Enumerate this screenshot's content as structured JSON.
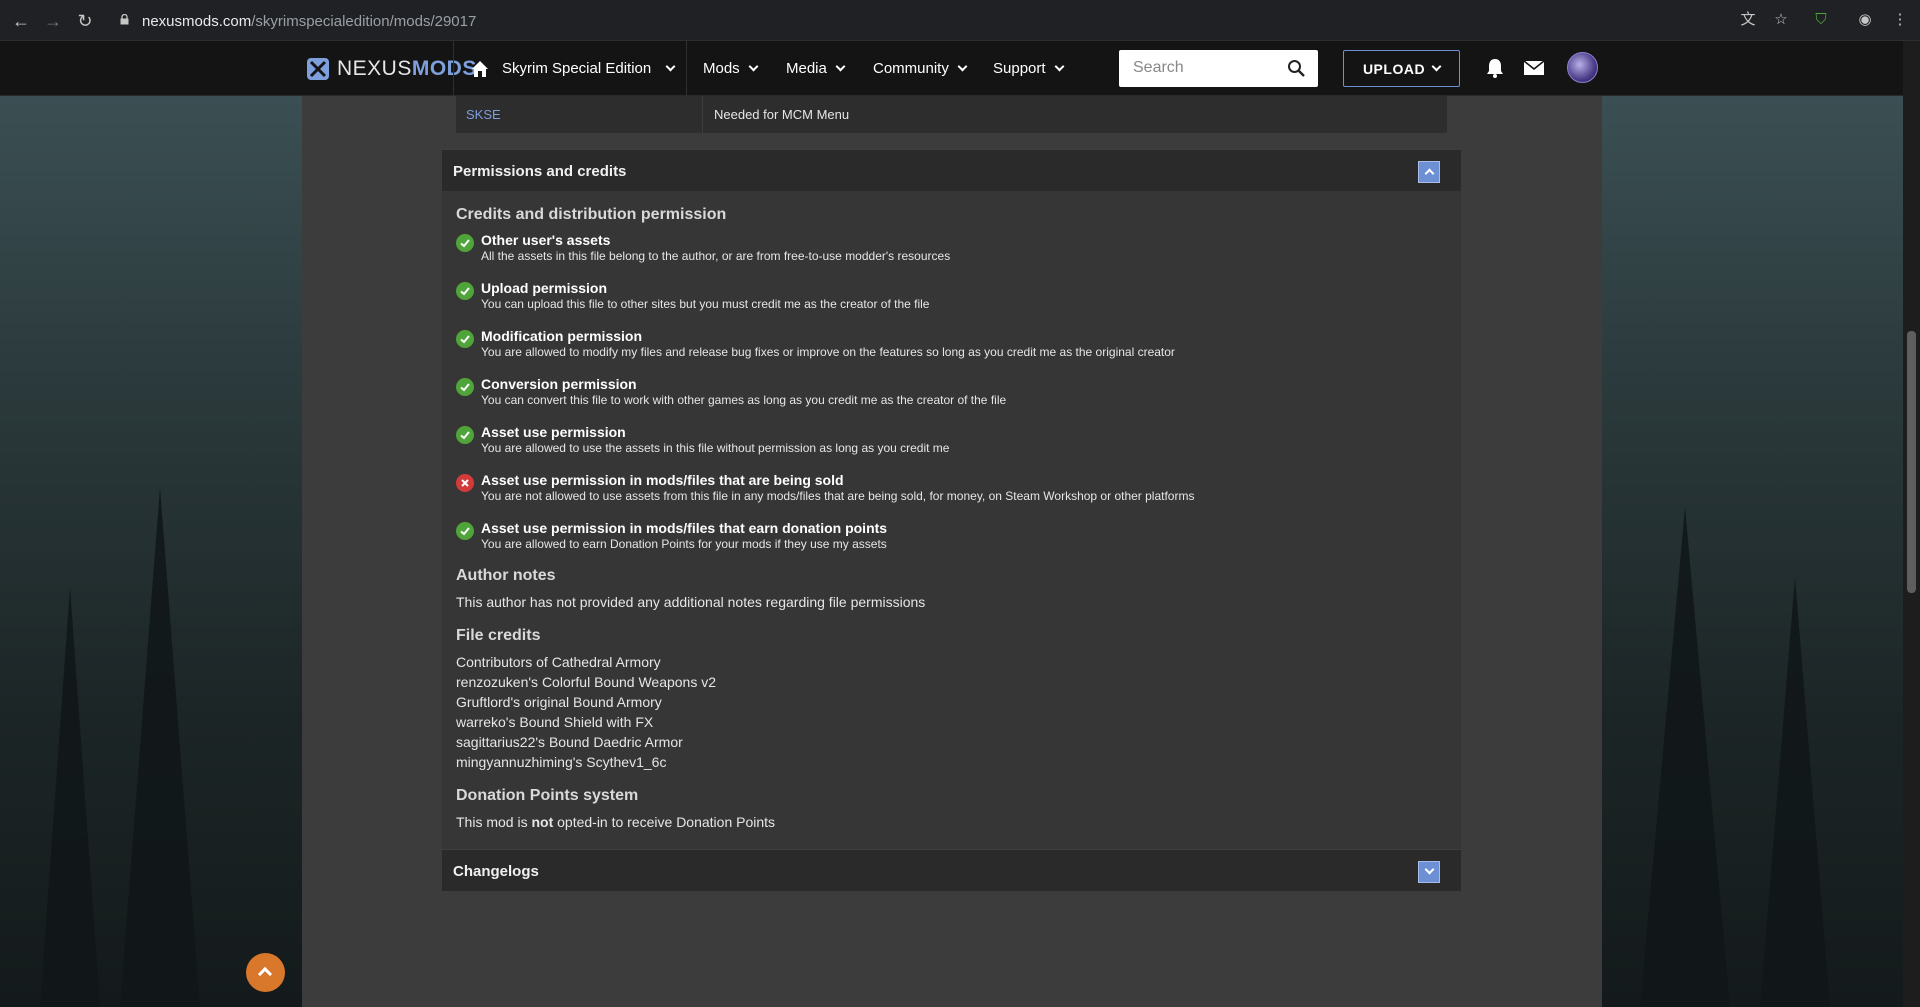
{
  "browser": {
    "url_host": "nexusmods.com",
    "url_path": "/skyrimspecialedition/mods/29017"
  },
  "header": {
    "logo_a": "NEXUS",
    "logo_b": "MODS",
    "game": "Skyrim Special Edition",
    "nav": [
      "Mods",
      "Media",
      "Community",
      "Support"
    ],
    "search_placeholder": "Search",
    "upload_label": "UPLOAD"
  },
  "requirements": {
    "name": "SKSE",
    "notes": "Needed for MCM Menu"
  },
  "permissions_section": {
    "title": "Permissions and credits",
    "credits_heading": "Credits and distribution permission",
    "items": [
      {
        "status": "allowed",
        "title": "Other user's assets",
        "desc": "All the assets in this file belong to the author, or are from free-to-use modder's resources"
      },
      {
        "status": "allowed",
        "title": "Upload permission",
        "desc": "You can upload this file to other sites but you must credit me as the creator of the file"
      },
      {
        "status": "allowed",
        "title": "Modification permission",
        "desc": "You are allowed to modify my files and release bug fixes or improve on the features so long as you credit me as the original creator"
      },
      {
        "status": "allowed",
        "title": "Conversion permission",
        "desc": "You can convert this file to work with other games as long as you credit me as the creator of the file"
      },
      {
        "status": "allowed",
        "title": "Asset use permission",
        "desc": "You are allowed to use the assets in this file without permission as long as you credit me"
      },
      {
        "status": "denied",
        "title": "Asset use permission in mods/files that are being sold",
        "desc": "You are not allowed to use assets from this file in any mods/files that are being sold, for money, on Steam Workshop or other platforms"
      },
      {
        "status": "allowed",
        "title": "Asset use permission in mods/files that earn donation points",
        "desc": "You are allowed to earn Donation Points for your mods if they use my assets"
      }
    ],
    "author_notes_heading": "Author notes",
    "author_notes": "This author has not provided any additional notes regarding file permissions",
    "file_credits_heading": "File credits",
    "file_credits": [
      "Contributors of Cathedral Armory",
      "renzozuken's Colorful Bound Weapons v2",
      "Gruftlord's original Bound Armory",
      "warreko's Bound Shield with FX",
      "sagittarius22's Bound Daedric Armor",
      "mingyannuzhiming's Scythev1_6c"
    ],
    "donation_heading": "Donation Points system",
    "donation_pre": "This mod is ",
    "donation_bold": "not",
    "donation_post": " opted-in to receive Donation Points"
  },
  "changelogs_section": {
    "title": "Changelogs"
  },
  "colors": {
    "accent": "#6d8fd4",
    "allowed": "#4fa43a",
    "denied": "#d33b3b",
    "scroll_top": "#d9772b"
  }
}
